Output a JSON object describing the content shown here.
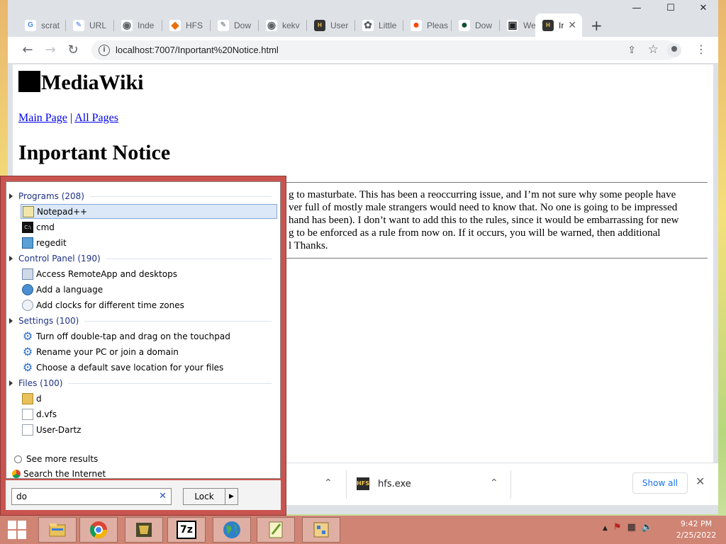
{
  "browser": {
    "tabs": [
      {
        "label": "scrat",
        "icon": "google-icon",
        "color": "#4285f4",
        "glyph": "G"
      },
      {
        "label": "URL",
        "icon": "link-icon",
        "color": "#8ab4f8",
        "glyph": "✎"
      },
      {
        "label": "Inde",
        "icon": "globe-icon",
        "color": "#5f6368",
        "glyph": "◉"
      },
      {
        "label": "HFS",
        "icon": "hfs-icon",
        "color": "#e8710a",
        "glyph": "◆"
      },
      {
        "label": "Dow",
        "icon": "download-icon",
        "color": "#9aa0a6",
        "glyph": "✎"
      },
      {
        "label": "kekv",
        "icon": "globe-icon",
        "color": "#5f6368",
        "glyph": "◉"
      },
      {
        "label": "User",
        "icon": "hfs-icon",
        "color": "#333333",
        "glyph": "H"
      },
      {
        "label": "Little",
        "icon": "puzzle-icon",
        "color": "#5f6368",
        "glyph": "✿"
      },
      {
        "label": "Pleas",
        "icon": "reddit-icon",
        "color": "#ff4500",
        "glyph": "●"
      },
      {
        "label": "Dow",
        "icon": "leaf-icon",
        "color": "#0f5132",
        "glyph": "●"
      },
      {
        "label": "Web",
        "icon": "archive-icon",
        "color": "#202124",
        "glyph": "▣"
      },
      {
        "label": "Ir",
        "icon": "hfs-icon",
        "color": "#333333",
        "glyph": "H",
        "active": true
      }
    ],
    "new_tab": "+",
    "window_controls": {
      "minimize": "—",
      "maximize": "☐",
      "close": "✕"
    },
    "nav": {
      "back": "←",
      "forward": "→",
      "reload": "↻"
    },
    "url": "localhost:7007/Inportant%20Notice.html",
    "info": "i",
    "menu": "⋮"
  },
  "page": {
    "site_title": "MediaWiki",
    "links": {
      "main": "Main Page",
      "separator": "|",
      "all": "All Pages"
    },
    "title": "Inportant Notice",
    "lines": [
      "g to masturbate. This has been a reoccurring issue, and I’m not sure why some people have",
      "ver full of mostly male strangers would need to know that. No one is going to be impressed",
      "hand has been). I don’t want to add this to the rules, since it would be embarrassing for new",
      "g to be enforced as a rule from now on. If it occurs, you will be warned, then additional",
      "l Thanks."
    ]
  },
  "downloads": {
    "item": "hfs.exe",
    "show_all": "Show all",
    "close": "✕",
    "chevron": "⌃"
  },
  "start_menu": {
    "groups": [
      {
        "label": "Programs (208)",
        "items": [
          {
            "label": "Notepad++",
            "icon": "notepadpp-icon",
            "selected": true
          },
          {
            "label": "cmd",
            "icon": "cmd-icon"
          },
          {
            "label": "regedit",
            "icon": "regedit-icon"
          }
        ]
      },
      {
        "label": "Control Panel (190)",
        "items": [
          {
            "label": "Access RemoteApp and desktops",
            "icon": "remoteapp-icon"
          },
          {
            "label": "Add a language",
            "icon": "language-icon"
          },
          {
            "label": "Add clocks for different time zones",
            "icon": "clock-icon"
          }
        ]
      },
      {
        "label": "Settings (100)",
        "items": [
          {
            "label": "Turn off double-tap and drag on the touchpad",
            "icon": "gear-icon"
          },
          {
            "label": "Rename your PC or join a domain",
            "icon": "gear-icon"
          },
          {
            "label": "Choose a default save location for your files",
            "icon": "gear-icon"
          }
        ]
      },
      {
        "label": "Files (100)",
        "items": [
          {
            "label": "d",
            "icon": "folder-icon"
          },
          {
            "label": "d.vfs",
            "icon": "file-icon"
          },
          {
            "label": "User-Dartz",
            "icon": "file-icon"
          }
        ]
      }
    ],
    "see_more": "See more results",
    "search_internet": "Search the Internet",
    "search_value": "do",
    "search_clear": "✕",
    "lock_label": "Lock",
    "lock_arrow": "▶"
  },
  "taskbar": {
    "apps": [
      "file-explorer-icon",
      "chrome-icon",
      "hfs-app-icon",
      "7zip-icon",
      "globe-app-icon",
      "notepadpp-app-icon",
      "app-icon"
    ],
    "seven_zip": "7z",
    "tray_up": "▲",
    "time": "9:42 PM",
    "date": "2/25/2022"
  }
}
